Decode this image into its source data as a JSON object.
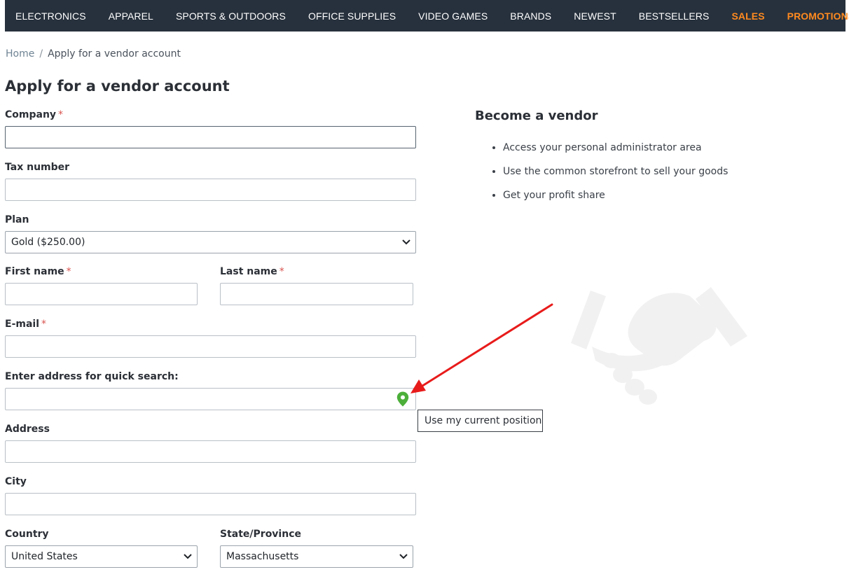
{
  "nav": {
    "items": [
      "ELECTRONICS",
      "APPAREL",
      "SPORTS & OUTDOORS",
      "OFFICE SUPPLIES",
      "VIDEO GAMES",
      "BRANDS",
      "NEWEST",
      "BESTSELLERS"
    ],
    "sales": "SALES",
    "promotions": "PROMOTIONS"
  },
  "breadcrumb": {
    "home": "Home",
    "separator": "/",
    "current": "Apply for a vendor account"
  },
  "page_title": "Apply for a vendor account",
  "form": {
    "required_mark": "*",
    "company": {
      "label": "Company",
      "value": ""
    },
    "tax_number": {
      "label": "Tax number",
      "value": ""
    },
    "plan": {
      "label": "Plan",
      "selected": "Gold ($250.00)"
    },
    "first_name": {
      "label": "First name",
      "value": ""
    },
    "last_name": {
      "label": "Last name",
      "value": ""
    },
    "email": {
      "label": "E-mail",
      "value": ""
    },
    "quick_search": {
      "label": "Enter address for quick search:",
      "value": ""
    },
    "address": {
      "label": "Address",
      "value": ""
    },
    "city": {
      "label": "City",
      "value": ""
    },
    "country": {
      "label": "Country",
      "selected": "United States"
    },
    "state": {
      "label": "State/Province",
      "selected": "Massachusetts"
    }
  },
  "tooltip": "Use my current position",
  "sidebar": {
    "title": "Become a vendor",
    "benefits": [
      "Access your personal administrator area",
      "Use the common storefront to sell your goods",
      "Get your profit share"
    ]
  },
  "icons": {
    "location_pin": "map-pin-icon",
    "dropdown": "chevron-down-icon",
    "illustration": "handshake-icon"
  },
  "colors": {
    "nav_bg": "#27313d",
    "nav_highlight": "#ff8a1f",
    "required": "#d9534f",
    "pin": "#4caf3a",
    "annotation_arrow": "#e81b1b"
  }
}
